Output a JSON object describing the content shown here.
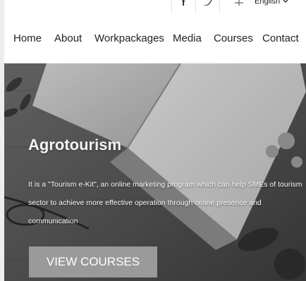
{
  "topbar": {
    "social": [
      {
        "name": "facebook-icon",
        "glyph": "f"
      },
      {
        "name": "twitter-icon",
        "glyph": "❀"
      }
    ],
    "language": {
      "selected": "English"
    }
  },
  "nav": {
    "items": [
      {
        "label": "Home"
      },
      {
        "label": "About"
      },
      {
        "label": "Workpackages"
      },
      {
        "label": "Media"
      },
      {
        "label": "Courses"
      },
      {
        "label": "Contact"
      }
    ]
  },
  "hero": {
    "title": "Agrotourism",
    "description": "It is a \"Tourism e-Kit\", an online marketing program which can help SMEs of tourism sector to achieve more effective operation through online presence and communication",
    "button_label": "VIEW COURSES"
  },
  "colors": {
    "button": "#9a9a9a",
    "text_dark": "#222222"
  }
}
